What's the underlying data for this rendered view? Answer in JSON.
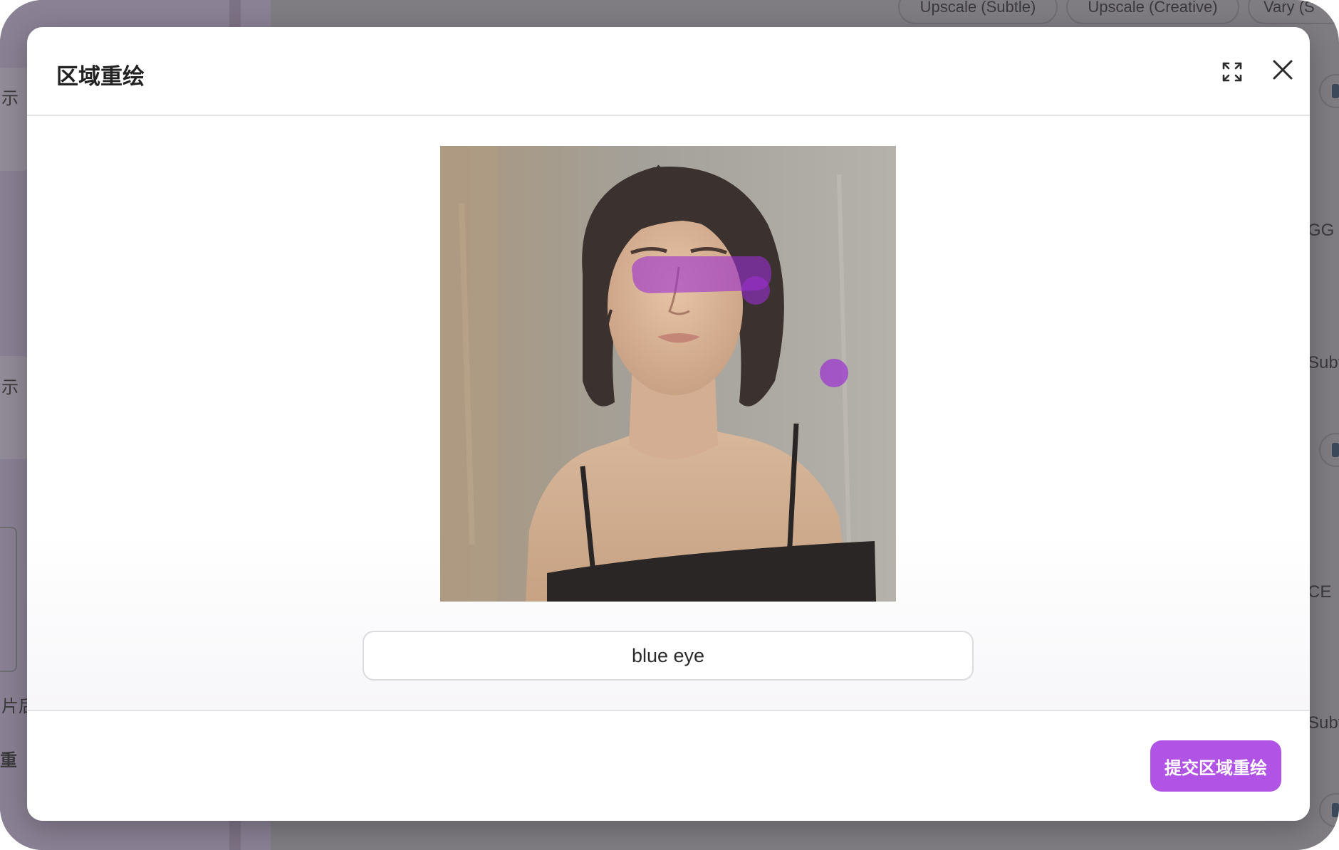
{
  "background": {
    "sidebar_labels": [
      "示",
      "示",
      "片后",
      "重"
    ],
    "right_labels": [
      "GG",
      "Subt",
      "CE",
      "Subt"
    ],
    "top_pills": [
      "Upscale (Subtle)",
      "Upscale (Creative)",
      "Vary (S"
    ]
  },
  "modal": {
    "title": "区域重绘",
    "fullscreen_icon": "expand-icon",
    "close_icon": "close-icon",
    "image_description": "Oil-painting portrait of a woman with dark hair and black top on gray background",
    "mask": {
      "color": "#9b2fd0",
      "strokes": [
        "horizontal stroke over the eyes",
        "dot on the right background"
      ]
    },
    "prompt": {
      "value": "blue eye",
      "placeholder": ""
    },
    "submit_label": "提交区域重绘",
    "accent_color": "#b154e6"
  }
}
